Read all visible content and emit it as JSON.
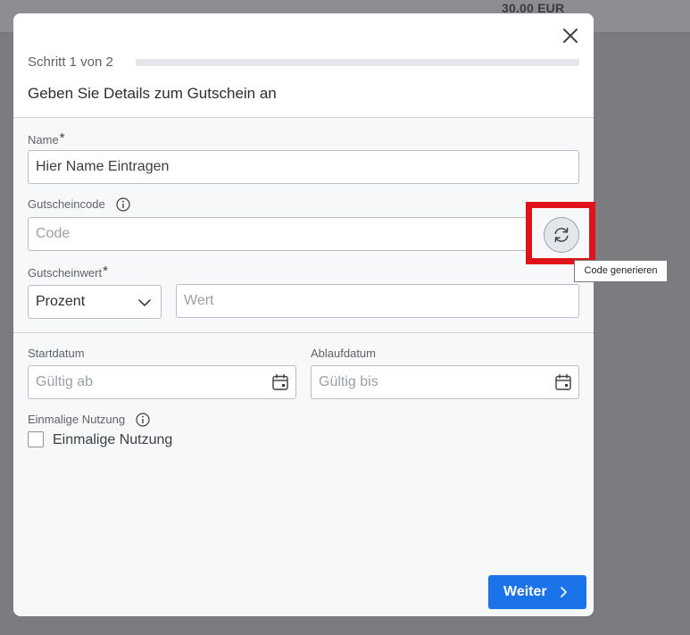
{
  "background": {
    "price": "30,00 EUR"
  },
  "modal": {
    "step_label": "Schritt 1 von 2",
    "step_current": 1,
    "step_total": 2,
    "progress_fraction": 0.0,
    "heading": "Geben Sie Details zum Gutschein an",
    "close_icon": "close-icon"
  },
  "form": {
    "name": {
      "label": "Name",
      "required_mark": "*",
      "value": "",
      "placeholder": "Hier Name Eintragen"
    },
    "voucher_code": {
      "label": "Gutscheincode",
      "info_icon": "info-icon",
      "value": "",
      "placeholder": "Code",
      "generate_icon": "refresh-icon",
      "tooltip": "Code generieren"
    },
    "voucher_value": {
      "label": "Gutscheinwert",
      "required_mark": "*",
      "type_selected": "Prozent",
      "value": "",
      "placeholder": "Wert"
    },
    "start_date": {
      "label": "Startdatum",
      "value": "",
      "placeholder": "Gültig ab",
      "icon": "calendar-icon"
    },
    "expiry_date": {
      "label": "Ablaufdatum",
      "value": "",
      "placeholder": "Gültig bis",
      "icon": "calendar-icon"
    },
    "single_use": {
      "label": "Einmalige Nutzung",
      "info_icon": "info-icon",
      "checkbox_label": "Einmalige Nutzung",
      "checked": false
    }
  },
  "footer": {
    "next_label": "Weiter",
    "next_icon": "chevron-right-icon"
  },
  "colors": {
    "accent": "#1a73e8",
    "highlight": "#e0131a",
    "overlay": "#7b7b80"
  }
}
